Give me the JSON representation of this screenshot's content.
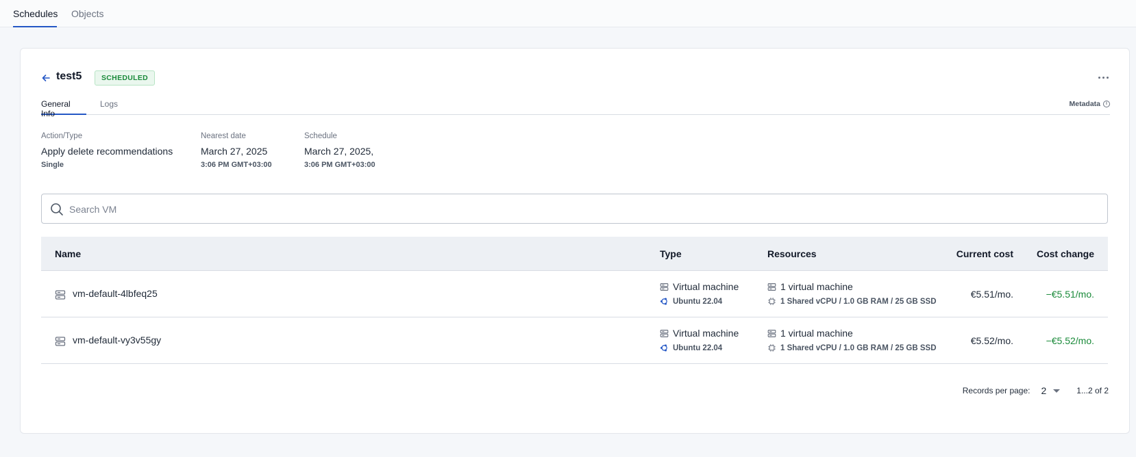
{
  "top_tabs": [
    {
      "label": "Schedules",
      "active": true
    },
    {
      "label": "Objects",
      "active": false
    }
  ],
  "header": {
    "title": "test5",
    "status": "SCHEDULED"
  },
  "inner_tabs": [
    {
      "label": "General Info",
      "active": true
    },
    {
      "label": "Logs",
      "active": false
    }
  ],
  "metadata_label": "Metadata",
  "info": {
    "action": {
      "label": "Action/Type",
      "value": "Apply delete recommendations",
      "sub": "Single"
    },
    "nearest": {
      "label": "Nearest date",
      "value": "March 27, 2025",
      "sub": "3:06 PM GMT+03:00"
    },
    "schedule": {
      "label": "Schedule",
      "value": "March 27, 2025,",
      "sub": "3:06 PM GMT+03:00"
    }
  },
  "search": {
    "placeholder": "Search VM",
    "value": ""
  },
  "table": {
    "headers": {
      "name": "Name",
      "type": "Type",
      "resources": "Resources",
      "current_cost": "Current cost",
      "cost_change": "Cost change"
    },
    "rows": [
      {
        "name": "vm-default-4lbfeq25",
        "type": "Virtual machine",
        "os": "Ubuntu 22.04",
        "resources": "1 virtual machine",
        "resources_detail": "1 Shared vCPU / 1.0 GB RAM / 25 GB SSD",
        "current_cost": "€5.51/mo.",
        "cost_change": "−€5.51/mo."
      },
      {
        "name": "vm-default-vy3v55gy",
        "type": "Virtual machine",
        "os": "Ubuntu 22.04",
        "resources": "1 virtual machine",
        "resources_detail": "1 Shared vCPU / 1.0 GB RAM / 25 GB SSD",
        "current_cost": "€5.52/mo.",
        "cost_change": "−€5.52/mo."
      }
    ]
  },
  "pager": {
    "label": "Records per page:",
    "per_page": "2",
    "range": "1...2 of 2"
  },
  "colors": {
    "accent": "#2457c5",
    "success": "#1a8a3a",
    "badge_bg": "#eaf7ee"
  },
  "icons": {
    "back": "arrow-left-icon",
    "more": "more-horizontal-icon",
    "info": "info-icon",
    "search": "search-icon",
    "server": "server-icon",
    "ubuntu": "ubuntu-icon",
    "cpu": "cpu-icon",
    "caret": "caret-down-icon"
  }
}
